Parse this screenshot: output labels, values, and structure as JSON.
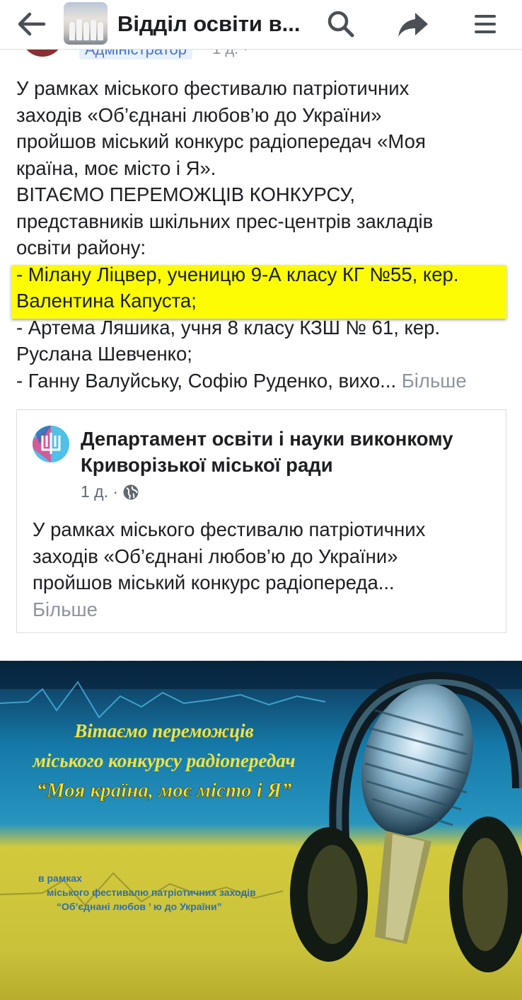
{
  "header": {
    "title": "Відділ освіти в...",
    "back_icon": "arrow-left-icon",
    "search_icon": "search-icon",
    "share_icon": "share-icon",
    "menu_icon": "menu-icon"
  },
  "author": {
    "role": "Адміністратор",
    "time": "1 д. · "
  },
  "post": {
    "lines": [
      "У рамках міського фестивалю патріотичних",
      "заходів «Об’єднані любов’ю до України»",
      "пройшов міський конкурс радіопередач «Моя",
      "країна, моє місто і Я».",
      "ВІТАЄМО ПЕРЕМОЖЦІВ КОНКУРСУ,",
      "представників шкільних прес-центрів закладів",
      "освіти району:",
      "- Мілану Ліцвер, ученицю 9-А класу КГ №55, кер.",
      "Валентина Капуста;",
      "- Артема Ляшика, учня 8 класу КЗШ № 61, кер.",
      "Руслана Шевченко;"
    ],
    "last_line": "- Ганну Валуйську, Софію Руденко, вихо... ",
    "more": "Більше",
    "highlight_color": "#fdfc05"
  },
  "shared": {
    "org_name_line1": "Департамент освіти і науки виконкому",
    "org_name_line2": "Криворізької міської ради",
    "time": "1 д. · ",
    "privacy_icon": "globe-icon",
    "lines": [
      "У рамках міського фестивалю патріотичних",
      "заходів «Об’єднані любов’ю до України»",
      "пройшов міський конкурс радіопереда..."
    ],
    "more": "Більше"
  },
  "banner": {
    "line1": "Вітаємо переможців",
    "line2": "міського конкурсу радіопередач",
    "line3": "“Моя країна, моє місто і Я”",
    "small1": "в рамках",
    "small2": "міського фестивалю патріотичних заходів",
    "small3": "“Об’єднані любов ’ ю до України”",
    "colors": {
      "blue": "#1679a8",
      "yellow": "#c9c23a",
      "title_text": "#f4e23c"
    }
  }
}
